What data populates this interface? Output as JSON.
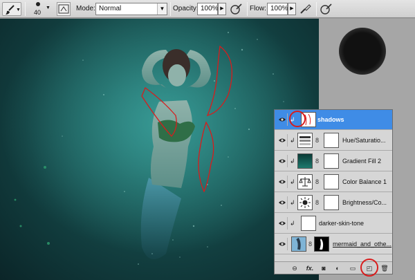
{
  "options_bar": {
    "brush_size": "40",
    "mode_label": "Mode:",
    "mode_value": "Normal",
    "opacity_label": "Opacity:",
    "opacity_value": "100%",
    "flow_label": "Flow:",
    "flow_value": "100%"
  },
  "layers": [
    {
      "name": "shadows",
      "selected": true,
      "clipped": true,
      "thumb": "transparent-checker",
      "mask": false
    },
    {
      "name": "Hue/Saturatio...",
      "selected": false,
      "clipped": true,
      "thumb": "hue-saturation-icon",
      "mask": true
    },
    {
      "name": "Gradient Fill 2",
      "selected": false,
      "clipped": true,
      "thumb": "gradient-fill-icon",
      "mask": true
    },
    {
      "name": "Color Balance 1",
      "selected": false,
      "clipped": true,
      "thumb": "balance-scale-icon",
      "mask": true
    },
    {
      "name": "Brightness/Co...",
      "selected": false,
      "clipped": true,
      "thumb": "brightness-sun-icon",
      "mask": true
    },
    {
      "name": "darker-skin-tone",
      "selected": false,
      "clipped": true,
      "thumb": "transparent-checker",
      "mask": false
    },
    {
      "name": "mermaid_and_othe...",
      "selected": false,
      "clipped": false,
      "thumb": "mermaid-photo-thumb",
      "mask": true
    }
  ],
  "footer_buttons": [
    "link-layers-icon",
    "fx-icon",
    "add-mask-icon",
    "adjustment-layer-icon",
    "new-group-icon",
    "new-layer-icon",
    "trash-icon"
  ],
  "footer_fx_label": "fx.",
  "accent_colors": {
    "selection": "#3f8ce6",
    "annotation": "#d81c1c"
  }
}
